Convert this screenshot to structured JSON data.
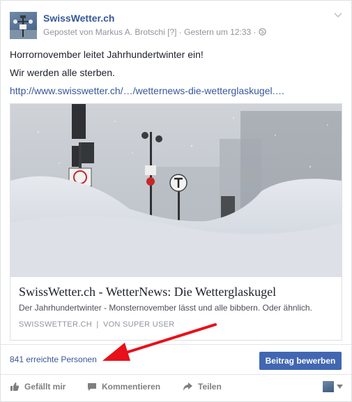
{
  "post": {
    "page_name": "SwissWetter.ch",
    "meta_prefix": "Gepostet von",
    "author": "Markus A. Brotschi",
    "author_tag": "[?]",
    "timestamp": "Gestern um 12:33",
    "separator": "·",
    "line1": "Horrornovember leitet Jahrhundertwinter ein!",
    "line2": "Wir werden alle sterben.",
    "link": "http://www.swisswetter.ch/…/wetternews-die-wetterglaskugel.…"
  },
  "preview": {
    "title": "SwissWetter.ch - WetterNews: Die Wetterglaskugel",
    "description": "Der Jahrhundertwinter - Monsternovember lässt und alle bibbern. Oder ähnlich.",
    "source": "SWISSWETTER.CH",
    "source_sep": "|",
    "source_by": "VON SUPER USER"
  },
  "stats": {
    "reach": "841 erreichte Personen",
    "boost_label": "Beitrag bewerben"
  },
  "actions": {
    "like": "Gefällt mir",
    "comment": "Kommentieren",
    "share": "Teilen"
  },
  "colors": {
    "link": "#365899",
    "button": "#4267b2",
    "arrow": "#e8101a"
  }
}
